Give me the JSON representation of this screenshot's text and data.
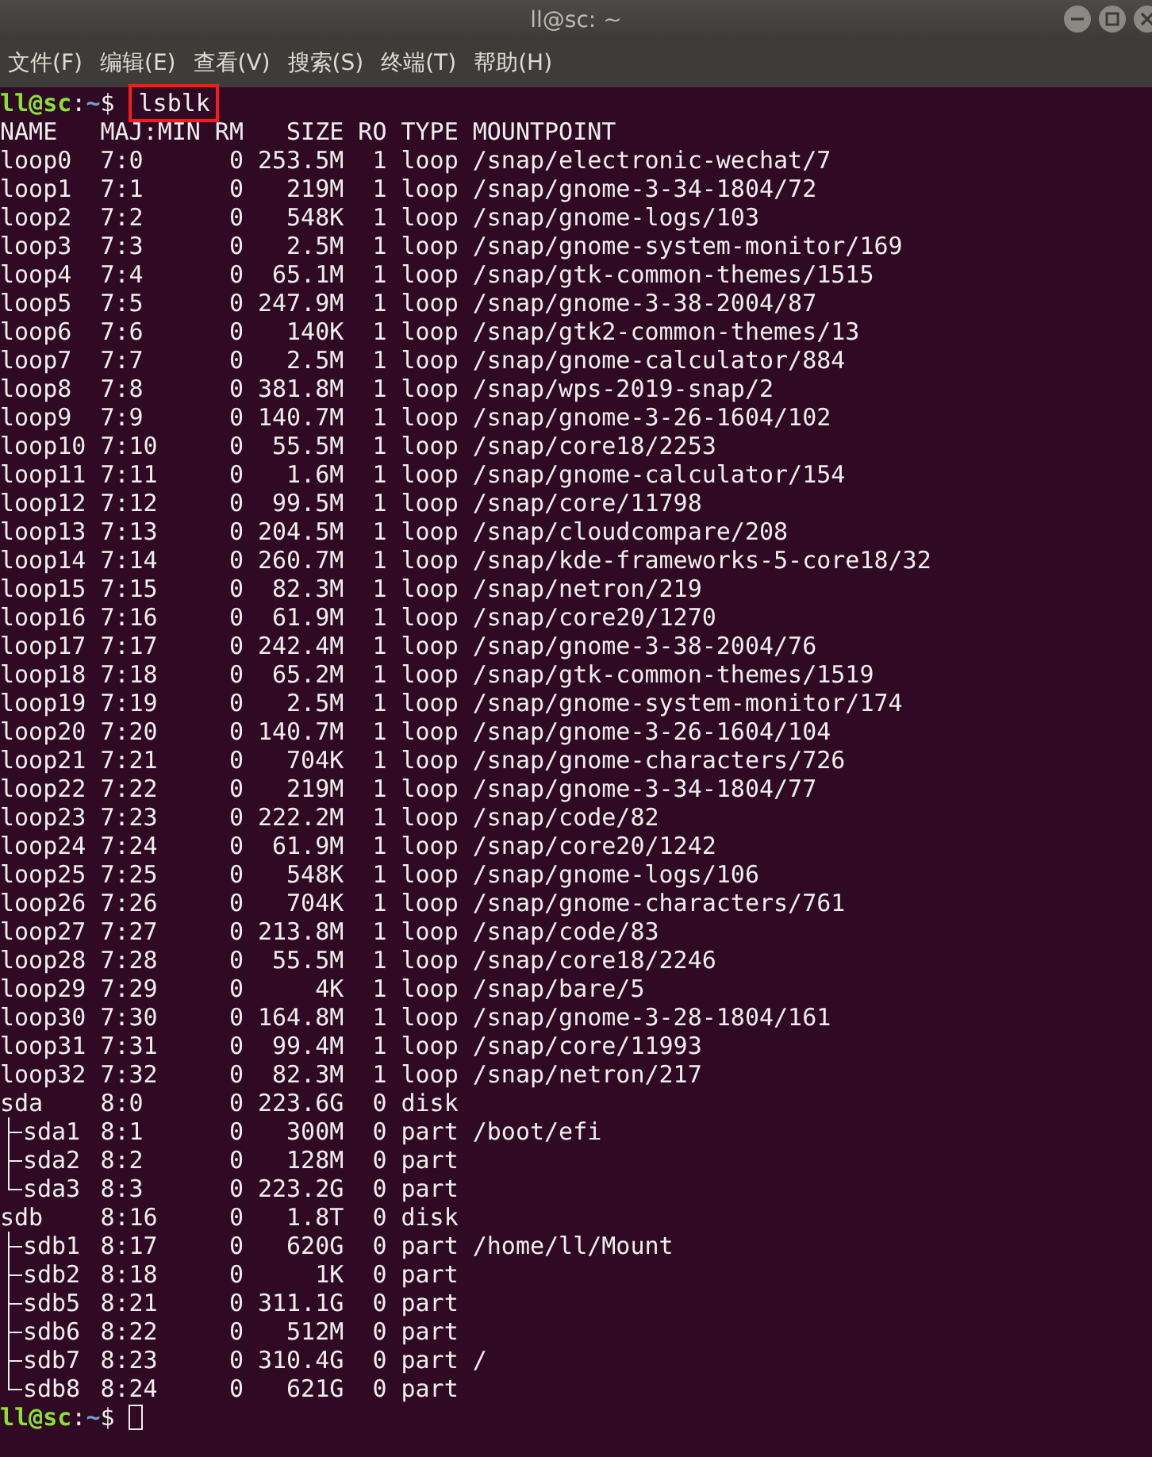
{
  "window": {
    "title": "ll@sc: ~"
  },
  "menu": [
    "文件(F)",
    "编辑(E)",
    "查看(V)",
    "搜索(S)",
    "终端(T)",
    "帮助(H)"
  ],
  "terminal": {
    "command_prompt": {
      "user": "ll@sc",
      "separator": ":",
      "path": "~",
      "symbol": "$",
      "command": "lsblk",
      "highlighted": true
    },
    "columns": [
      "NAME",
      "MAJ:MIN",
      "RM",
      "SIZE",
      "RO",
      "TYPE",
      "MOUNTPOINT"
    ],
    "rows": [
      {
        "name": "loop0",
        "maj_min": "7:0",
        "rm": "0",
        "size": "253.5M",
        "ro": "1",
        "type": "loop",
        "mountpoint": "/snap/electronic-wechat/7"
      },
      {
        "name": "loop1",
        "maj_min": "7:1",
        "rm": "0",
        "size": "219M",
        "ro": "1",
        "type": "loop",
        "mountpoint": "/snap/gnome-3-34-1804/72"
      },
      {
        "name": "loop2",
        "maj_min": "7:2",
        "rm": "0",
        "size": "548K",
        "ro": "1",
        "type": "loop",
        "mountpoint": "/snap/gnome-logs/103"
      },
      {
        "name": "loop3",
        "maj_min": "7:3",
        "rm": "0",
        "size": "2.5M",
        "ro": "1",
        "type": "loop",
        "mountpoint": "/snap/gnome-system-monitor/169"
      },
      {
        "name": "loop4",
        "maj_min": "7:4",
        "rm": "0",
        "size": "65.1M",
        "ro": "1",
        "type": "loop",
        "mountpoint": "/snap/gtk-common-themes/1515"
      },
      {
        "name": "loop5",
        "maj_min": "7:5",
        "rm": "0",
        "size": "247.9M",
        "ro": "1",
        "type": "loop",
        "mountpoint": "/snap/gnome-3-38-2004/87"
      },
      {
        "name": "loop6",
        "maj_min": "7:6",
        "rm": "0",
        "size": "140K",
        "ro": "1",
        "type": "loop",
        "mountpoint": "/snap/gtk2-common-themes/13"
      },
      {
        "name": "loop7",
        "maj_min": "7:7",
        "rm": "0",
        "size": "2.5M",
        "ro": "1",
        "type": "loop",
        "mountpoint": "/snap/gnome-calculator/884"
      },
      {
        "name": "loop8",
        "maj_min": "7:8",
        "rm": "0",
        "size": "381.8M",
        "ro": "1",
        "type": "loop",
        "mountpoint": "/snap/wps-2019-snap/2"
      },
      {
        "name": "loop9",
        "maj_min": "7:9",
        "rm": "0",
        "size": "140.7M",
        "ro": "1",
        "type": "loop",
        "mountpoint": "/snap/gnome-3-26-1604/102"
      },
      {
        "name": "loop10",
        "maj_min": "7:10",
        "rm": "0",
        "size": "55.5M",
        "ro": "1",
        "type": "loop",
        "mountpoint": "/snap/core18/2253"
      },
      {
        "name": "loop11",
        "maj_min": "7:11",
        "rm": "0",
        "size": "1.6M",
        "ro": "1",
        "type": "loop",
        "mountpoint": "/snap/gnome-calculator/154"
      },
      {
        "name": "loop12",
        "maj_min": "7:12",
        "rm": "0",
        "size": "99.5M",
        "ro": "1",
        "type": "loop",
        "mountpoint": "/snap/core/11798"
      },
      {
        "name": "loop13",
        "maj_min": "7:13",
        "rm": "0",
        "size": "204.5M",
        "ro": "1",
        "type": "loop",
        "mountpoint": "/snap/cloudcompare/208"
      },
      {
        "name": "loop14",
        "maj_min": "7:14",
        "rm": "0",
        "size": "260.7M",
        "ro": "1",
        "type": "loop",
        "mountpoint": "/snap/kde-frameworks-5-core18/32"
      },
      {
        "name": "loop15",
        "maj_min": "7:15",
        "rm": "0",
        "size": "82.3M",
        "ro": "1",
        "type": "loop",
        "mountpoint": "/snap/netron/219"
      },
      {
        "name": "loop16",
        "maj_min": "7:16",
        "rm": "0",
        "size": "61.9M",
        "ro": "1",
        "type": "loop",
        "mountpoint": "/snap/core20/1270"
      },
      {
        "name": "loop17",
        "maj_min": "7:17",
        "rm": "0",
        "size": "242.4M",
        "ro": "1",
        "type": "loop",
        "mountpoint": "/snap/gnome-3-38-2004/76"
      },
      {
        "name": "loop18",
        "maj_min": "7:18",
        "rm": "0",
        "size": "65.2M",
        "ro": "1",
        "type": "loop",
        "mountpoint": "/snap/gtk-common-themes/1519"
      },
      {
        "name": "loop19",
        "maj_min": "7:19",
        "rm": "0",
        "size": "2.5M",
        "ro": "1",
        "type": "loop",
        "mountpoint": "/snap/gnome-system-monitor/174"
      },
      {
        "name": "loop20",
        "maj_min": "7:20",
        "rm": "0",
        "size": "140.7M",
        "ro": "1",
        "type": "loop",
        "mountpoint": "/snap/gnome-3-26-1604/104"
      },
      {
        "name": "loop21",
        "maj_min": "7:21",
        "rm": "0",
        "size": "704K",
        "ro": "1",
        "type": "loop",
        "mountpoint": "/snap/gnome-characters/726"
      },
      {
        "name": "loop22",
        "maj_min": "7:22",
        "rm": "0",
        "size": "219M",
        "ro": "1",
        "type": "loop",
        "mountpoint": "/snap/gnome-3-34-1804/77"
      },
      {
        "name": "loop23",
        "maj_min": "7:23",
        "rm": "0",
        "size": "222.2M",
        "ro": "1",
        "type": "loop",
        "mountpoint": "/snap/code/82"
      },
      {
        "name": "loop24",
        "maj_min": "7:24",
        "rm": "0",
        "size": "61.9M",
        "ro": "1",
        "type": "loop",
        "mountpoint": "/snap/core20/1242"
      },
      {
        "name": "loop25",
        "maj_min": "7:25",
        "rm": "0",
        "size": "548K",
        "ro": "1",
        "type": "loop",
        "mountpoint": "/snap/gnome-logs/106"
      },
      {
        "name": "loop26",
        "maj_min": "7:26",
        "rm": "0",
        "size": "704K",
        "ro": "1",
        "type": "loop",
        "mountpoint": "/snap/gnome-characters/761"
      },
      {
        "name": "loop27",
        "maj_min": "7:27",
        "rm": "0",
        "size": "213.8M",
        "ro": "1",
        "type": "loop",
        "mountpoint": "/snap/code/83"
      },
      {
        "name": "loop28",
        "maj_min": "7:28",
        "rm": "0",
        "size": "55.5M",
        "ro": "1",
        "type": "loop",
        "mountpoint": "/snap/core18/2246"
      },
      {
        "name": "loop29",
        "maj_min": "7:29",
        "rm": "0",
        "size": "4K",
        "ro": "1",
        "type": "loop",
        "mountpoint": "/snap/bare/5"
      },
      {
        "name": "loop30",
        "maj_min": "7:30",
        "rm": "0",
        "size": "164.8M",
        "ro": "1",
        "type": "loop",
        "mountpoint": "/snap/gnome-3-28-1804/161"
      },
      {
        "name": "loop31",
        "maj_min": "7:31",
        "rm": "0",
        "size": "99.4M",
        "ro": "1",
        "type": "loop",
        "mountpoint": "/snap/core/11993"
      },
      {
        "name": "loop32",
        "maj_min": "7:32",
        "rm": "0",
        "size": "82.3M",
        "ro": "1",
        "type": "loop",
        "mountpoint": "/snap/netron/217"
      },
      {
        "name": "sda",
        "maj_min": "8:0",
        "rm": "0",
        "size": "223.6G",
        "ro": "0",
        "type": "disk",
        "children": [
          {
            "name": "sda1",
            "maj_min": "8:1",
            "rm": "0",
            "size": "300M",
            "ro": "0",
            "type": "part",
            "mountpoint": "/boot/efi"
          },
          {
            "name": "sda2",
            "maj_min": "8:2",
            "rm": "0",
            "size": "128M",
            "ro": "0",
            "type": "part"
          },
          {
            "name": "sda3",
            "maj_min": "8:3",
            "rm": "0",
            "size": "223.2G",
            "ro": "0",
            "type": "part"
          }
        ]
      },
      {
        "name": "sdb",
        "maj_min": "8:16",
        "rm": "0",
        "size": "1.8T",
        "ro": "0",
        "type": "disk",
        "children": [
          {
            "name": "sdb1",
            "maj_min": "8:17",
            "rm": "0",
            "size": "620G",
            "ro": "0",
            "type": "part",
            "mountpoint": "/home/ll/Mount"
          },
          {
            "name": "sdb2",
            "maj_min": "8:18",
            "rm": "0",
            "size": "1K",
            "ro": "0",
            "type": "part"
          },
          {
            "name": "sdb5",
            "maj_min": "8:21",
            "rm": "0",
            "size": "311.1G",
            "ro": "0",
            "type": "part"
          },
          {
            "name": "sdb6",
            "maj_min": "8:22",
            "rm": "0",
            "size": "512M",
            "ro": "0",
            "type": "part"
          },
          {
            "name": "sdb7",
            "maj_min": "8:23",
            "rm": "0",
            "size": "310.4G",
            "ro": "0",
            "type": "part",
            "mountpoint": "/"
          },
          {
            "name": "sdb8",
            "maj_min": "8:24",
            "rm": "0",
            "size": "621G",
            "ro": "0",
            "type": "part"
          }
        ]
      }
    ],
    "final_prompt": {
      "user": "ll@sc",
      "separator": ":",
      "path": "~",
      "symbol": "$",
      "cursor": true
    }
  }
}
